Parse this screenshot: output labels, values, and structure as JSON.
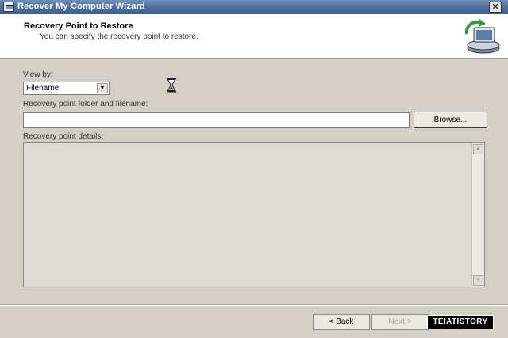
{
  "window": {
    "title": "Recover My Computer Wizard",
    "close_glyph": "✕"
  },
  "header": {
    "title": "Recovery Point to Restore",
    "subtitle": "You can specify the recovery point to restore.",
    "icon": "computer-restore-icon"
  },
  "form": {
    "view_by_label": "View by:",
    "view_by_selected": "Filename",
    "path_label": "Recovery point folder and filename:",
    "path_value": "",
    "browse_label": "Browse...",
    "details_label": "Recovery point details:"
  },
  "footer": {
    "back_label": "< Back",
    "next_label": "Next >",
    "next_enabled": false
  },
  "watermark": {
    "text": "TEIATISTORY"
  },
  "colors": {
    "titlebar": "#4d6f9c",
    "dialog_bg": "#d4d0c8",
    "header_bg": "#ffffff"
  }
}
